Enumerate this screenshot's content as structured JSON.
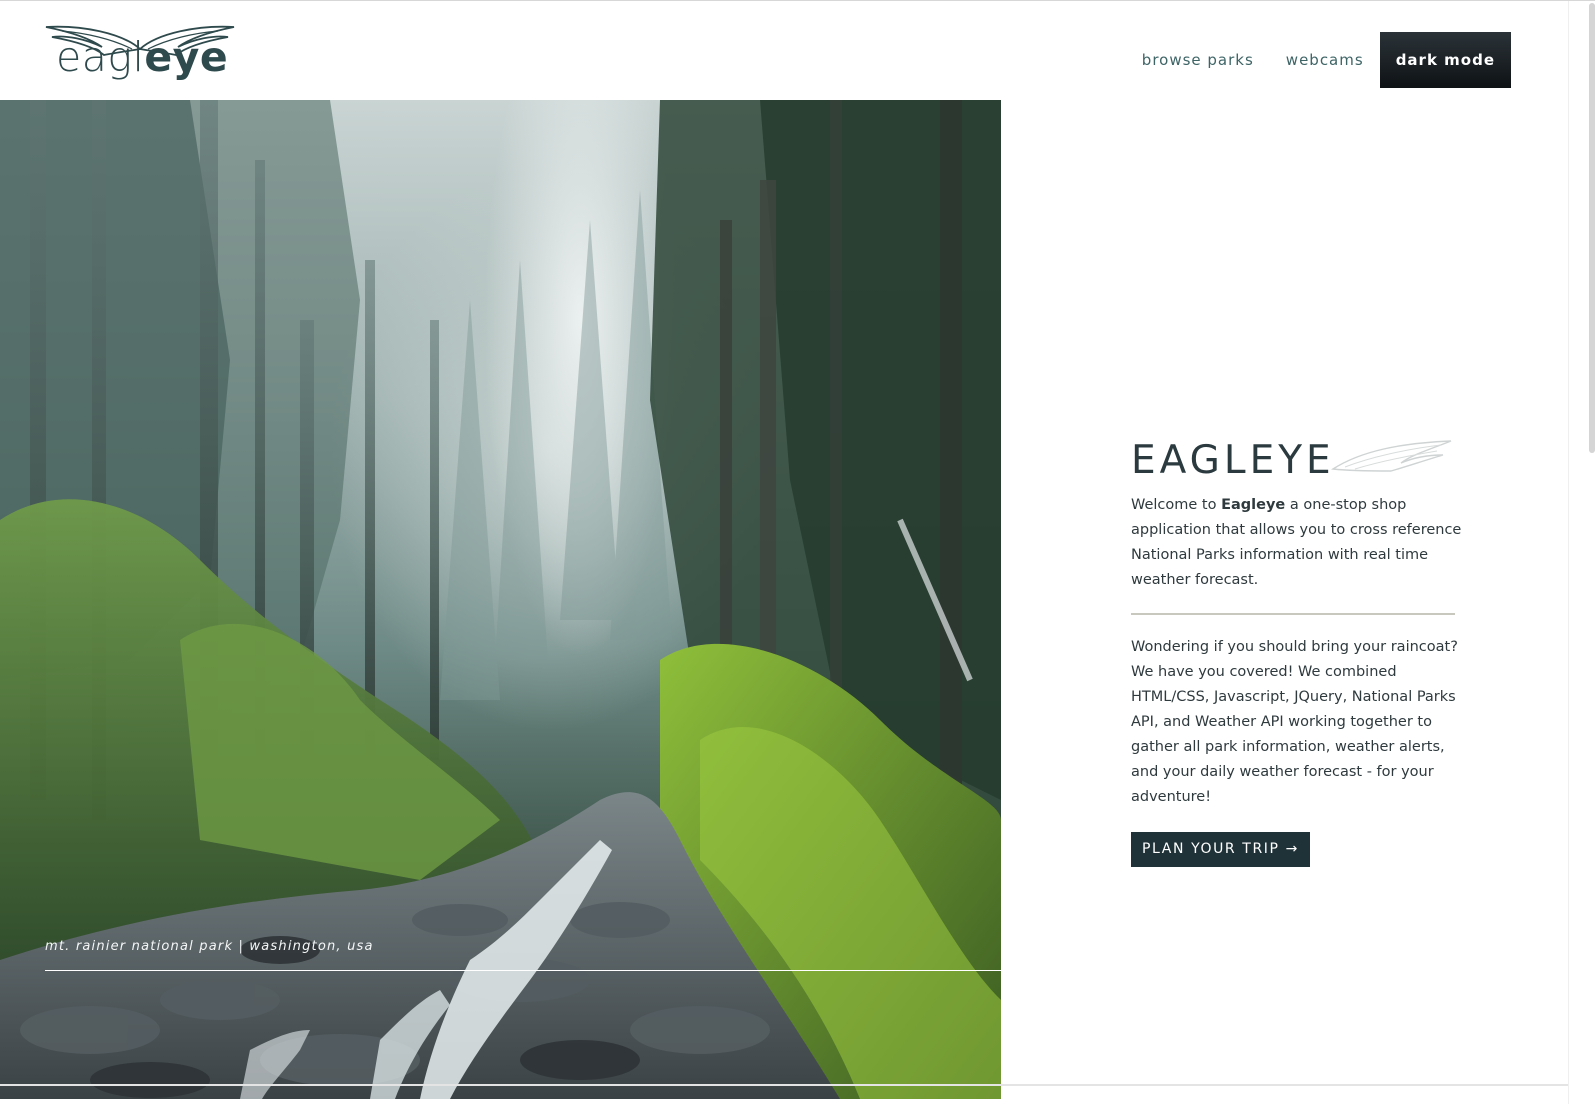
{
  "header": {
    "logo": {
      "text_light": "eagl",
      "text_bold": "eye",
      "icon": "wings-icon"
    },
    "nav": {
      "browse_parks": "browse parks",
      "webcams": "webcams",
      "dark_mode": "dark mode"
    }
  },
  "hero": {
    "caption": "mt. rainier national park | washington, usa"
  },
  "intro": {
    "title": "EAGLEYE",
    "title_icon": "wing-icon",
    "welcome_prefix": "Welcome to ",
    "welcome_brand": "Eagleye",
    "welcome_suffix": " a one-stop shop application that allows you to cross reference National Parks information with real time weather forecast.",
    "description": "Wondering if you should bring your raincoat? We have you covered! We combined HTML/CSS, Javascript, JQuery, National Parks API, and Weather API working together to gather all park information, weather alerts, and your daily weather forecast - for your adventure!",
    "cta_label": "PLAN YOUR TRIP →"
  },
  "colors": {
    "brand_dark": "#1f3238",
    "nav_link": "#3e6466",
    "divider": "#c9c8be"
  }
}
